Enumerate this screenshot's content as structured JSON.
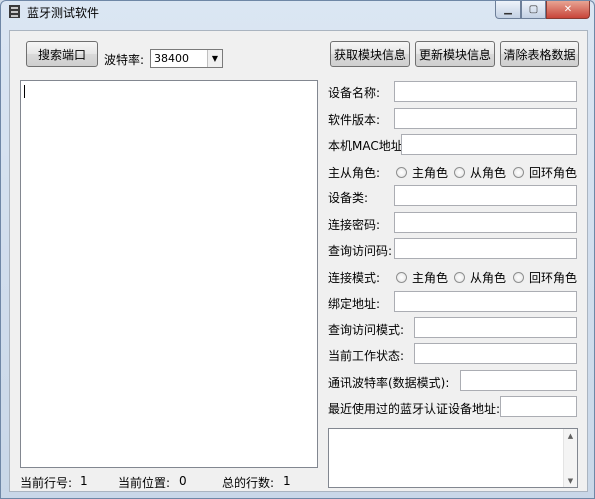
{
  "window": {
    "title": "蓝牙测试软件"
  },
  "toolbar": {
    "search_port": "搜索端口",
    "baud_label": "波特率:",
    "baud_value": "38400",
    "get_info": "获取模块信息",
    "update_info": "更新模块信息",
    "clear_table": "清除表格数据"
  },
  "form": {
    "device_name": "设备名称:",
    "software_version": "软件版本:",
    "local_mac": "本机MAC地址:",
    "master_slave_role": "主从角色:",
    "device_class": "设备类:",
    "connect_password": "连接密码:",
    "inquiry_access_code": "查询访问码:",
    "connect_mode": "连接模式:",
    "bind_address": "绑定地址:",
    "inquiry_access_mode": "查询访问模式:",
    "current_work_state": "当前工作状态:",
    "comm_baud": "通讯波特率(数据模式):",
    "recent_device_address": "最近使用过的蓝牙认证设备地址:"
  },
  "roles": [
    "主角色",
    "从角色",
    "回环角色"
  ],
  "status": {
    "current_row_label": "当前行号:",
    "current_row_value": "1",
    "current_pos_label": "当前位置:",
    "current_pos_value": "0",
    "total_rows_label": "总的行数:",
    "total_rows_value": "1"
  }
}
